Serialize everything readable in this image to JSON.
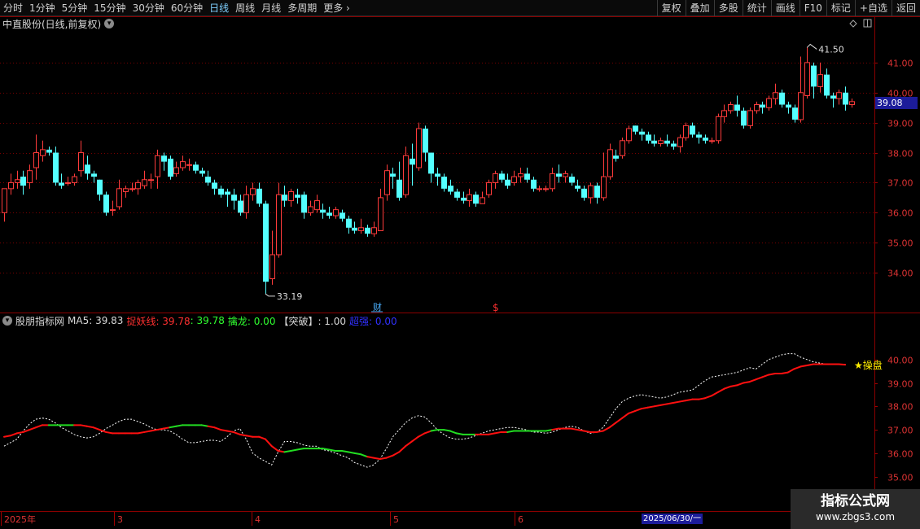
{
  "toolbar": {
    "left_items": [
      "分时",
      "1分钟",
      "5分钟",
      "15分钟",
      "30分钟",
      "60分钟",
      "日线",
      "周线",
      "月线",
      "多周期",
      "更多"
    ],
    "active": "日线",
    "right_items": [
      "复权",
      "叠加",
      "多股",
      "统计",
      "画线",
      "F10",
      "标记",
      "+自选",
      "返回"
    ]
  },
  "stock_title": "中直股份(日线,前复权)",
  "current_price": "39.08",
  "indicator_row": {
    "name": "股朋指标网",
    "ma5_label": "MA5: 39.83",
    "line1_label": "捉妖线: 39.78",
    "line2_label": ": 39.78",
    "line3_label": "擒龙: 0.00",
    "line4_label": "【突破】: 1.00",
    "line5_label": "超强: 0.00"
  },
  "annotations": {
    "high": "41.50",
    "low": "33.19",
    "cai": "财",
    "dollar": "$",
    "star_label": "★操盘"
  },
  "xaxis": {
    "labels": [
      "2025年",
      "3",
      "4",
      "5",
      "6"
    ],
    "cursor_date": "2025/06/30/一"
  },
  "watermark": {
    "line1": "指标公式网",
    "line2": "www.zbgs3.com"
  },
  "colors": {
    "up": "#ff3b3b",
    "down": "#54ffff",
    "grid": "#7a0000",
    "ma_red": "#ff1010",
    "ma_green": "#22dd22",
    "dotted": "#ffffff"
  },
  "chart_data": {
    "type": "candlestick",
    "price_axis": {
      "ylim": [
        33.0,
        42.0
      ],
      "ticks": [
        34.0,
        35.0,
        36.0,
        37.0,
        38.0,
        39.0,
        40.0,
        41.0
      ]
    },
    "indicator_axis": {
      "ylim": [
        34.5,
        41.0
      ],
      "ticks": [
        35.0,
        36.0,
        37.0,
        38.0,
        39.0,
        40.0
      ]
    },
    "candles": [
      [
        36.0,
        36.8,
        36.5,
        35.7
      ],
      [
        36.8,
        37.0,
        37.3,
        36.6
      ],
      [
        37.0,
        37.1,
        37.4,
        36.8
      ],
      [
        37.2,
        36.9,
        37.4,
        36.6
      ],
      [
        37.0,
        37.4,
        37.6,
        36.8
      ],
      [
        37.5,
        38.0,
        38.6,
        37.1
      ],
      [
        37.9,
        38.1,
        38.4,
        37.7
      ],
      [
        38.1,
        38.0,
        38.2,
        37.9
      ],
      [
        38.0,
        37.0,
        38.2,
        36.9
      ],
      [
        37.0,
        36.9,
        37.3,
        36.8
      ],
      [
        37.0,
        37.0,
        37.2,
        36.9
      ],
      [
        37.0,
        37.2,
        37.3,
        36.9
      ],
      [
        37.4,
        38.0,
        38.4,
        37.2
      ],
      [
        37.6,
        37.3,
        37.9,
        37.1
      ],
      [
        37.3,
        37.2,
        37.4,
        37.0
      ],
      [
        37.1,
        36.6,
        37.1,
        36.4
      ],
      [
        36.6,
        36.0,
        36.7,
        35.9
      ],
      [
        36.1,
        36.1,
        36.4,
        35.9
      ],
      [
        36.2,
        36.8,
        37.1,
        36.1
      ],
      [
        36.7,
        36.8,
        36.9,
        36.5
      ],
      [
        36.8,
        36.8,
        37.0,
        36.7
      ],
      [
        36.8,
        37.0,
        37.1,
        36.6
      ],
      [
        36.9,
        37.1,
        37.4,
        36.8
      ],
      [
        37.1,
        37.1,
        37.3,
        36.8
      ],
      [
        37.2,
        37.9,
        38.1,
        36.8
      ],
      [
        37.9,
        37.7,
        38.0,
        37.4
      ],
      [
        37.8,
        37.2,
        37.9,
        37.1
      ],
      [
        37.3,
        37.5,
        37.7,
        37.2
      ],
      [
        37.5,
        37.7,
        37.9,
        37.4
      ],
      [
        37.6,
        37.6,
        37.8,
        37.4
      ],
      [
        37.6,
        37.4,
        37.7,
        37.3
      ],
      [
        37.4,
        37.3,
        37.5,
        37.2
      ],
      [
        37.2,
        37.0,
        37.4,
        36.9
      ],
      [
        37.0,
        36.8,
        37.1,
        36.6
      ],
      [
        36.8,
        36.6,
        36.9,
        36.5
      ],
      [
        36.7,
        36.6,
        36.8,
        36.2
      ],
      [
        36.6,
        36.4,
        36.8,
        36.1
      ],
      [
        36.4,
        36.0,
        36.6,
        35.9
      ],
      [
        36.0,
        36.6,
        36.9,
        35.8
      ],
      [
        36.6,
        36.8,
        37.0,
        36.4
      ],
      [
        36.8,
        36.3,
        37.0,
        36.2
      ],
      [
        36.3,
        33.7,
        36.4,
        33.3
      ],
      [
        33.8,
        34.6,
        35.4,
        33.6
      ],
      [
        34.6,
        36.6,
        37.0,
        34.5
      ],
      [
        36.6,
        36.4,
        36.9,
        36.2
      ],
      [
        36.4,
        36.7,
        36.8,
        36.2
      ],
      [
        36.6,
        36.5,
        36.8,
        36.3
      ],
      [
        36.6,
        36.0,
        36.7,
        35.8
      ],
      [
        36.0,
        36.2,
        36.4,
        35.9
      ],
      [
        36.1,
        36.4,
        36.6,
        36.0
      ],
      [
        36.1,
        36.0,
        36.3,
        35.8
      ],
      [
        36.0,
        35.9,
        36.2,
        35.8
      ],
      [
        35.9,
        36.1,
        36.2,
        35.8
      ],
      [
        36.0,
        35.8,
        36.1,
        35.7
      ],
      [
        35.8,
        35.5,
        35.9,
        35.3
      ],
      [
        35.5,
        35.4,
        35.7,
        35.3
      ],
      [
        35.4,
        35.5,
        35.8,
        35.3
      ],
      [
        35.5,
        35.3,
        35.6,
        35.2
      ],
      [
        35.3,
        35.5,
        35.7,
        35.2
      ],
      [
        35.4,
        36.5,
        36.8,
        35.4
      ],
      [
        36.6,
        37.4,
        37.6,
        36.4
      ],
      [
        37.3,
        37.2,
        37.5,
        36.8
      ],
      [
        37.1,
        36.5,
        37.7,
        36.4
      ],
      [
        36.6,
        37.9,
        38.2,
        36.5
      ],
      [
        37.8,
        37.6,
        38.3,
        36.9
      ],
      [
        37.5,
        38.8,
        39.0,
        37.4
      ],
      [
        38.8,
        38.0,
        38.9,
        37.7
      ],
      [
        38.0,
        37.3,
        38.0,
        37.0
      ],
      [
        37.3,
        37.2,
        37.5,
        36.9
      ],
      [
        37.2,
        36.8,
        37.3,
        36.7
      ],
      [
        36.9,
        36.7,
        37.1,
        36.6
      ],
      [
        36.7,
        36.5,
        36.8,
        36.4
      ],
      [
        36.5,
        36.4,
        36.7,
        36.3
      ],
      [
        36.4,
        36.6,
        36.8,
        36.2
      ],
      [
        36.6,
        36.3,
        36.7,
        36.2
      ],
      [
        36.3,
        36.5,
        36.7,
        36.3
      ],
      [
        36.6,
        37.0,
        37.1,
        36.5
      ],
      [
        37.0,
        37.3,
        37.4,
        36.8
      ],
      [
        37.3,
        37.1,
        37.4,
        37.0
      ],
      [
        37.1,
        36.9,
        37.3,
        36.8
      ],
      [
        37.0,
        37.2,
        37.4,
        36.9
      ],
      [
        37.2,
        37.3,
        37.5,
        37.0
      ],
      [
        37.3,
        37.1,
        37.5,
        37.0
      ],
      [
        37.1,
        36.8,
        37.2,
        36.7
      ],
      [
        36.8,
        36.8,
        36.9,
        36.7
      ],
      [
        36.8,
        36.8,
        36.9,
        36.7
      ],
      [
        36.8,
        37.3,
        37.5,
        36.7
      ],
      [
        37.3,
        37.2,
        37.6,
        37.0
      ],
      [
        37.2,
        37.3,
        37.4,
        37.0
      ],
      [
        37.2,
        37.0,
        37.3,
        36.9
      ],
      [
        36.9,
        36.8,
        37.1,
        36.7
      ],
      [
        36.8,
        36.5,
        36.9,
        36.4
      ],
      [
        36.5,
        36.9,
        37.0,
        36.3
      ],
      [
        36.9,
        36.5,
        37.0,
        36.3
      ],
      [
        36.5,
        37.2,
        38.0,
        36.4
      ],
      [
        37.2,
        38.1,
        38.3,
        37.1
      ],
      [
        37.9,
        37.8,
        38.1,
        37.7
      ],
      [
        37.9,
        38.4,
        38.5,
        37.8
      ],
      [
        38.4,
        38.8,
        38.9,
        38.3
      ],
      [
        38.9,
        38.7,
        38.9,
        38.6
      ],
      [
        38.7,
        38.6,
        38.8,
        38.4
      ],
      [
        38.6,
        38.4,
        38.7,
        38.3
      ],
      [
        38.4,
        38.3,
        38.6,
        38.2
      ],
      [
        38.3,
        38.4,
        38.5,
        38.2
      ],
      [
        38.4,
        38.3,
        38.6,
        38.2
      ],
      [
        38.3,
        38.2,
        38.4,
        38.1
      ],
      [
        38.2,
        38.5,
        38.6,
        38.0
      ],
      [
        38.5,
        38.9,
        39.0,
        38.4
      ],
      [
        38.9,
        38.6,
        39.0,
        38.5
      ],
      [
        38.6,
        38.5,
        38.7,
        38.3
      ],
      [
        38.5,
        38.4,
        38.6,
        38.3
      ],
      [
        38.4,
        38.4,
        38.5,
        38.3
      ],
      [
        38.4,
        39.2,
        39.3,
        38.3
      ],
      [
        39.2,
        39.4,
        39.6,
        39.0
      ],
      [
        39.4,
        39.6,
        39.7,
        39.3
      ],
      [
        39.6,
        39.4,
        39.9,
        39.2
      ],
      [
        39.4,
        38.9,
        39.5,
        38.8
      ],
      [
        38.9,
        39.4,
        39.5,
        38.8
      ],
      [
        39.4,
        39.6,
        39.7,
        39.3
      ],
      [
        39.6,
        39.5,
        39.7,
        39.3
      ],
      [
        39.5,
        39.8,
        39.9,
        39.4
      ],
      [
        39.8,
        40.0,
        40.3,
        39.6
      ],
      [
        40.0,
        39.6,
        40.1,
        39.5
      ],
      [
        39.6,
        39.5,
        39.7,
        39.3
      ],
      [
        39.5,
        39.1,
        39.6,
        39.0
      ],
      [
        39.1,
        40.0,
        41.2,
        39.0
      ],
      [
        39.9,
        41.0,
        41.5,
        39.8
      ],
      [
        40.9,
        40.2,
        41.0,
        39.8
      ],
      [
        40.2,
        40.6,
        41.0,
        40.0
      ],
      [
        40.6,
        39.9,
        40.8,
        39.8
      ],
      [
        39.9,
        39.8,
        40.0,
        39.5
      ],
      [
        39.8,
        40.0,
        40.1,
        39.6
      ],
      [
        40.0,
        39.6,
        40.2,
        39.4
      ],
      [
        39.6,
        39.7,
        39.8,
        39.5
      ]
    ],
    "ma_line": [
      36.7,
      36.75,
      36.85,
      36.9,
      37.0,
      37.1,
      37.2,
      37.2,
      37.2,
      37.2,
      37.2,
      37.2,
      37.2,
      37.15,
      37.1,
      37.0,
      36.9,
      36.85,
      36.85,
      36.85,
      36.85,
      36.85,
      36.9,
      36.95,
      37.0,
      37.05,
      37.1,
      37.15,
      37.2,
      37.2,
      37.2,
      37.2,
      37.15,
      37.1,
      37.0,
      36.95,
      36.9,
      36.8,
      36.75,
      36.7,
      36.7,
      36.6,
      36.3,
      36.1,
      36.05,
      36.1,
      36.15,
      36.2,
      36.2,
      36.2,
      36.2,
      36.15,
      36.1,
      36.1,
      36.05,
      36.0,
      35.95,
      35.85,
      35.8,
      35.75,
      35.8,
      35.9,
      36.05,
      36.3,
      36.5,
      36.7,
      36.85,
      36.95,
      37.0,
      37.0,
      36.95,
      36.85,
      36.8,
      36.8,
      36.8,
      36.8,
      36.8,
      36.85,
      36.9,
      36.9,
      36.95,
      36.95,
      36.95,
      36.95,
      36.95,
      36.95,
      37.0,
      37.05,
      37.05,
      37.05,
      37.0,
      36.95,
      36.9,
      36.9,
      36.95,
      37.1,
      37.3,
      37.5,
      37.7,
      37.8,
      37.9,
      37.95,
      38.0,
      38.05,
      38.1,
      38.15,
      38.2,
      38.25,
      38.3,
      38.3,
      38.35,
      38.45,
      38.6,
      38.75,
      38.85,
      38.9,
      39.0,
      39.05,
      39.15,
      39.25,
      39.35,
      39.4,
      39.4,
      39.45,
      39.6,
      39.7,
      39.75,
      39.8,
      39.8,
      39.8,
      39.8,
      39.8,
      39.78
    ],
    "ma_green_ranges": [
      [
        7,
        11
      ],
      [
        26,
        32
      ],
      [
        44,
        57
      ],
      [
        67,
        74
      ],
      [
        79,
        86
      ]
    ],
    "dotted_line": [
      36.3,
      36.45,
      36.6,
      36.95,
      37.25,
      37.45,
      37.5,
      37.45,
      37.3,
      37.1,
      36.95,
      36.8,
      36.7,
      36.65,
      36.7,
      36.85,
      37.05,
      37.2,
      37.35,
      37.45,
      37.45,
      37.35,
      37.25,
      37.1,
      37.0,
      37.0,
      36.95,
      36.8,
      36.6,
      36.45,
      36.45,
      36.5,
      36.55,
      36.55,
      36.5,
      36.7,
      36.95,
      37.05,
      36.6,
      36.0,
      35.8,
      35.65,
      35.5,
      36.05,
      36.5,
      36.5,
      36.45,
      36.35,
      36.3,
      36.3,
      36.15,
      36.1,
      36.0,
      35.9,
      35.8,
      35.6,
      35.5,
      35.4,
      35.5,
      35.75,
      36.2,
      36.7,
      37.0,
      37.3,
      37.5,
      37.6,
      37.55,
      37.3,
      37.0,
      36.8,
      36.65,
      36.6,
      36.6,
      36.65,
      36.75,
      36.85,
      36.95,
      37.0,
      37.05,
      37.1,
      37.1,
      37.05,
      37.0,
      36.9,
      36.9,
      36.85,
      36.9,
      37.0,
      37.1,
      37.15,
      37.1,
      36.95,
      36.85,
      36.9,
      37.1,
      37.5,
      37.9,
      38.2,
      38.35,
      38.45,
      38.5,
      38.45,
      38.4,
      38.35,
      38.4,
      38.5,
      38.6,
      38.65,
      38.7,
      38.9,
      39.1,
      39.25,
      39.3,
      39.35,
      39.4,
      39.45,
      39.55,
      39.65,
      39.6,
      39.8,
      40.0,
      40.1,
      40.2,
      40.25,
      40.25,
      40.1,
      40.0,
      39.9,
      39.85,
      39.8,
      39.8,
      39.8,
      39.8
    ]
  }
}
